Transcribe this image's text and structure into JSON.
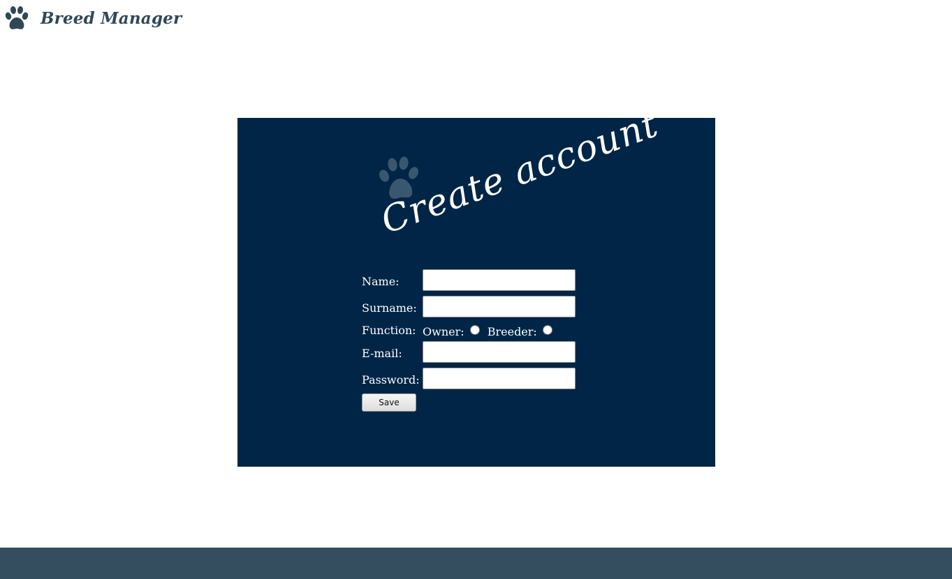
{
  "header": {
    "brand": "Breed Manager",
    "logo_icon": "paw-icon"
  },
  "card": {
    "title": "Create account",
    "icon": "paw-icon",
    "background": "#002546"
  },
  "form": {
    "name_label": "Name:",
    "name_value": "",
    "surname_label": "Surname:",
    "surname_value": "",
    "function_label": "Function:",
    "owner_label": "Owner:",
    "breeder_label": "Breeder:",
    "owner_checked": false,
    "breeder_checked": false,
    "email_label": "E-mail:",
    "email_value": "",
    "password_label": "Password:",
    "password_value": "",
    "save_label": "Save"
  },
  "colors": {
    "brand": "#2f4858",
    "footer": "#344d5f",
    "card": "#002546"
  }
}
